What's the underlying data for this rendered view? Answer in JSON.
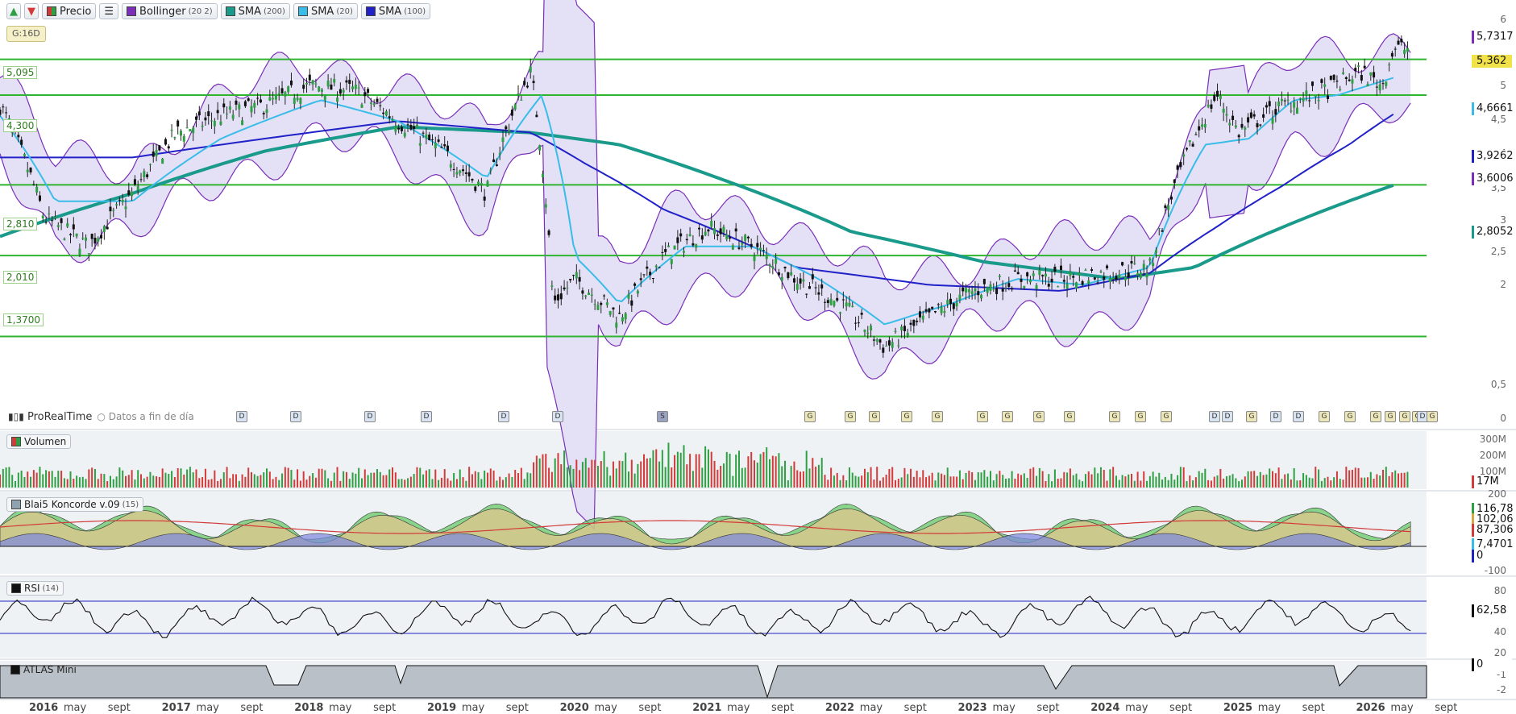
{
  "toolbar": {
    "up_arrow": "▲",
    "down_arrow": "▼",
    "precio": "Precio",
    "list_icon": "list-icon",
    "bollinger": "Bollinger",
    "bollinger_params": "(20 2)",
    "sma200": "SMA",
    "sma200_params": "(200)",
    "sma20": "SMA",
    "sma20_params": "(20)",
    "sma100": "SMA",
    "sma100_params": "(100)"
  },
  "badge_g16": "G:16D",
  "provider": {
    "name": "ProRealTime",
    "note": "Datos a fin de día"
  },
  "panels": {
    "volume": "Volumen",
    "koncorde": "Blai5 Koncorde v.09",
    "koncorde_params": "(15)",
    "rsi": "RSI",
    "rsi_params": "(14)",
    "atlas": "ATLAS Mini"
  },
  "levels": [
    {
      "label": "5,095",
      "value": 5.095
    },
    {
      "label": "4,300",
      "value": 4.3
    },
    {
      "label": "2,810",
      "value": 2.81
    },
    {
      "label": "2,010",
      "value": 2.01
    },
    {
      "label": "1,3700",
      "value": 1.37
    }
  ],
  "price_axis_ticks": [
    "6",
    "5",
    "4,5",
    "4",
    "3,5",
    "3",
    "2,5",
    "2",
    "0,5",
    "0"
  ],
  "value_tags": [
    {
      "label": "5,7317",
      "bg": "#ffffff",
      "border": "#7b2fb8"
    },
    {
      "label": "5,362",
      "bg": "#f1e24a",
      "border": "#f1e24a"
    },
    {
      "label": "4,6661",
      "bg": "#ffffff",
      "border": "#39bde8"
    },
    {
      "label": "3,9262",
      "bg": "#ffffff",
      "border": "#2121c8"
    },
    {
      "label": "3,6006",
      "bg": "#ffffff",
      "border": "#7b2fb8"
    },
    {
      "label": "2,8052",
      "bg": "#ffffff",
      "border": "#1a9a8a"
    }
  ],
  "volume_axis": [
    "300M",
    "200M",
    "100M"
  ],
  "volume_tag": "17M",
  "koncorde_axis": [
    "200",
    "-100"
  ],
  "koncorde_tags": [
    "116,78",
    "102,06",
    "87,306",
    "7,4701",
    "0"
  ],
  "rsi_axis": [
    "80",
    "60",
    "40",
    "20"
  ],
  "rsi_tag": "62,58",
  "atlas_axis": [
    "-1",
    "-2"
  ],
  "atlas_tag": "0",
  "x_labels": [
    "2016",
    "may",
    "sept",
    "2017",
    "may",
    "sept",
    "2018",
    "may",
    "sept",
    "2019",
    "may",
    "sept",
    "2020",
    "may",
    "sept",
    "2021",
    "may",
    "sept",
    "2022",
    "may",
    "sept",
    "2023",
    "may",
    "sept",
    "2024",
    "may",
    "sept",
    "2025",
    "may",
    "sept",
    "2026",
    "may",
    "sept"
  ],
  "events": [
    "D",
    "D",
    "D",
    "D",
    "D",
    "D",
    "S",
    "G",
    "G",
    "G",
    "G",
    "G",
    "G",
    "G",
    "G",
    "G",
    "G",
    "G",
    "G",
    "D",
    "D",
    "G",
    "D",
    "D",
    "G",
    "G",
    "G",
    "G",
    "G",
    "G",
    "D",
    "G"
  ],
  "colors": {
    "level": "#2fb42f",
    "bollinger": "#7b2fb8",
    "sma20": "#39bde8",
    "sma100": "#2121c8",
    "sma200": "#1a9a8a",
    "up": "#2ea043",
    "down": "#d33a3a"
  },
  "chart_data": {
    "type": "candlestick",
    "x_start": "2016-01",
    "x_end": "2026-09",
    "scale": "log",
    "ylim": [
      1.0,
      6.3
    ],
    "series": [
      {
        "name": "Precio",
        "x": [
          "2016-01",
          "2016-05",
          "2016-09",
          "2017-01",
          "2017-05",
          "2017-09",
          "2018-01",
          "2018-05",
          "2018-09",
          "2019-01",
          "2019-05",
          "2019-09",
          "2020-01",
          "2020-03",
          "2020-05",
          "2020-09",
          "2021-01",
          "2021-05",
          "2021-09",
          "2022-01",
          "2022-05",
          "2022-09",
          "2023-01",
          "2023-05",
          "2023-09",
          "2024-01",
          "2024-05",
          "2024-09",
          "2025-01",
          "2025-03",
          "2025-05",
          "2025-09",
          "2026-01",
          "2026-04",
          "2026-06",
          "2026-07"
        ],
        "values": [
          4.1,
          2.4,
          2.1,
          2.7,
          3.6,
          3.9,
          4.1,
          4.5,
          4.4,
          3.8,
          3.3,
          2.7,
          4.8,
          1.6,
          1.8,
          1.5,
          2.0,
          2.3,
          2.1,
          1.8,
          1.6,
          1.3,
          1.5,
          1.7,
          1.8,
          1.8,
          1.85,
          1.9,
          3.5,
          4.3,
          3.6,
          4.1,
          4.4,
          4.8,
          4.5,
          5.36
        ]
      },
      {
        "name": "SMA (20)",
        "x": [
          "2016-01",
          "2016-06",
          "2017-01",
          "2017-09",
          "2018-06",
          "2019-01",
          "2019-09",
          "2020-02",
          "2020-05",
          "2020-09",
          "2021-03",
          "2021-09",
          "2022-03",
          "2022-09",
          "2023-03",
          "2023-09",
          "2024-03",
          "2024-09",
          "2025-02",
          "2025-06",
          "2025-10",
          "2026-02",
          "2026-07"
        ],
        "values": [
          3.9,
          2.6,
          2.6,
          3.5,
          4.2,
          3.8,
          2.9,
          4.3,
          2.0,
          1.6,
          2.1,
          2.1,
          1.8,
          1.45,
          1.6,
          1.8,
          1.75,
          1.9,
          3.4,
          3.5,
          4.2,
          4.3,
          4.6661
        ]
      },
      {
        "name": "SMA (100)",
        "x": [
          "2016-01",
          "2017-01",
          "2018-01",
          "2019-01",
          "2020-01",
          "2020-06",
          "2021-01",
          "2022-01",
          "2023-01",
          "2024-01",
          "2024-09",
          "2025-03",
          "2025-09",
          "2026-03",
          "2026-07"
        ],
        "values": [
          3.2,
          3.2,
          3.5,
          3.8,
          3.6,
          3.1,
          2.5,
          1.9,
          1.75,
          1.7,
          1.85,
          2.3,
          2.8,
          3.4,
          3.9262
        ]
      },
      {
        "name": "SMA (200)",
        "x": [
          "2016-01",
          "2017-01",
          "2018-01",
          "2019-01",
          "2020-01",
          "2020-09",
          "2021-06",
          "2022-06",
          "2023-06",
          "2024-06",
          "2025-01",
          "2025-09",
          "2026-07"
        ],
        "values": [
          2.2,
          2.7,
          3.3,
          3.7,
          3.6,
          3.4,
          2.9,
          2.25,
          1.95,
          1.8,
          1.9,
          2.3,
          2.8052
        ]
      }
    ]
  }
}
